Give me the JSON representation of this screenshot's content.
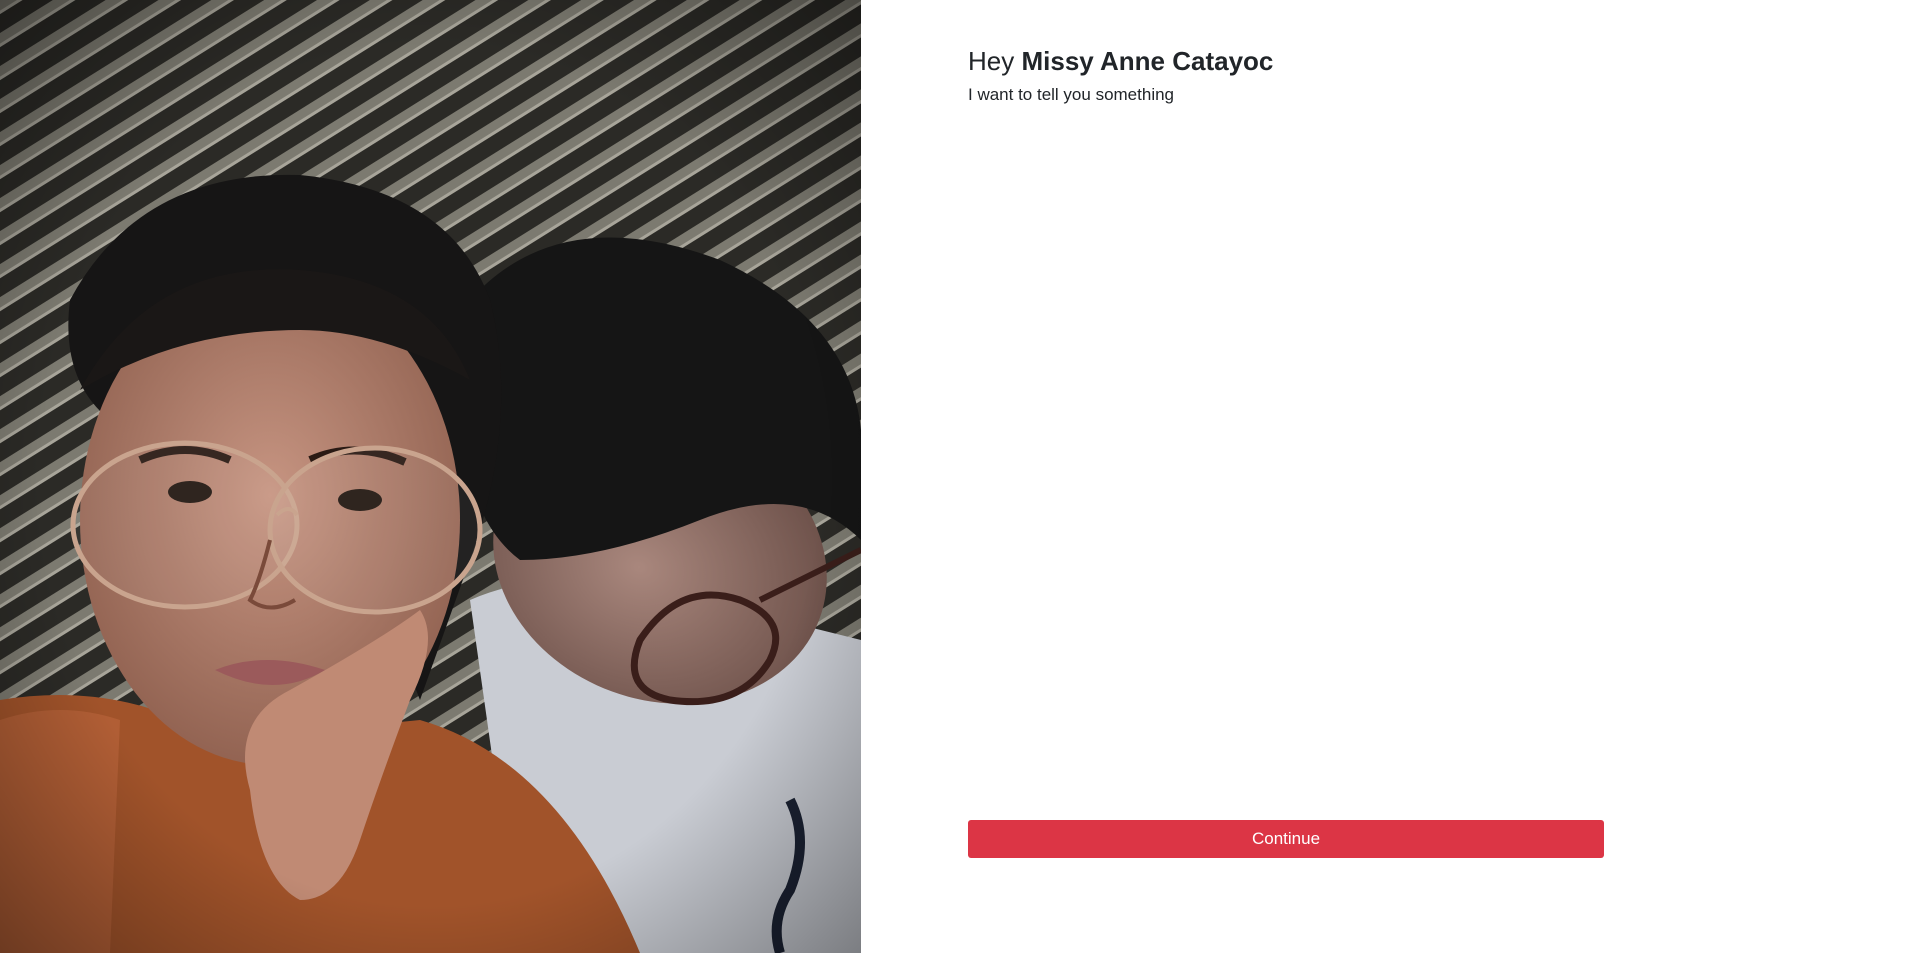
{
  "greeting": {
    "prefix": "Hey",
    "name": "Missy Anne Catayoc"
  },
  "subtitle": "I want to tell you something",
  "continue_label": "Continue",
  "photo": {
    "description_icon": "couple-selfie-photo"
  },
  "colors": {
    "button_bg": "#dc3545",
    "button_text": "#ffffff",
    "text": "#212529",
    "background": "#ffffff"
  }
}
